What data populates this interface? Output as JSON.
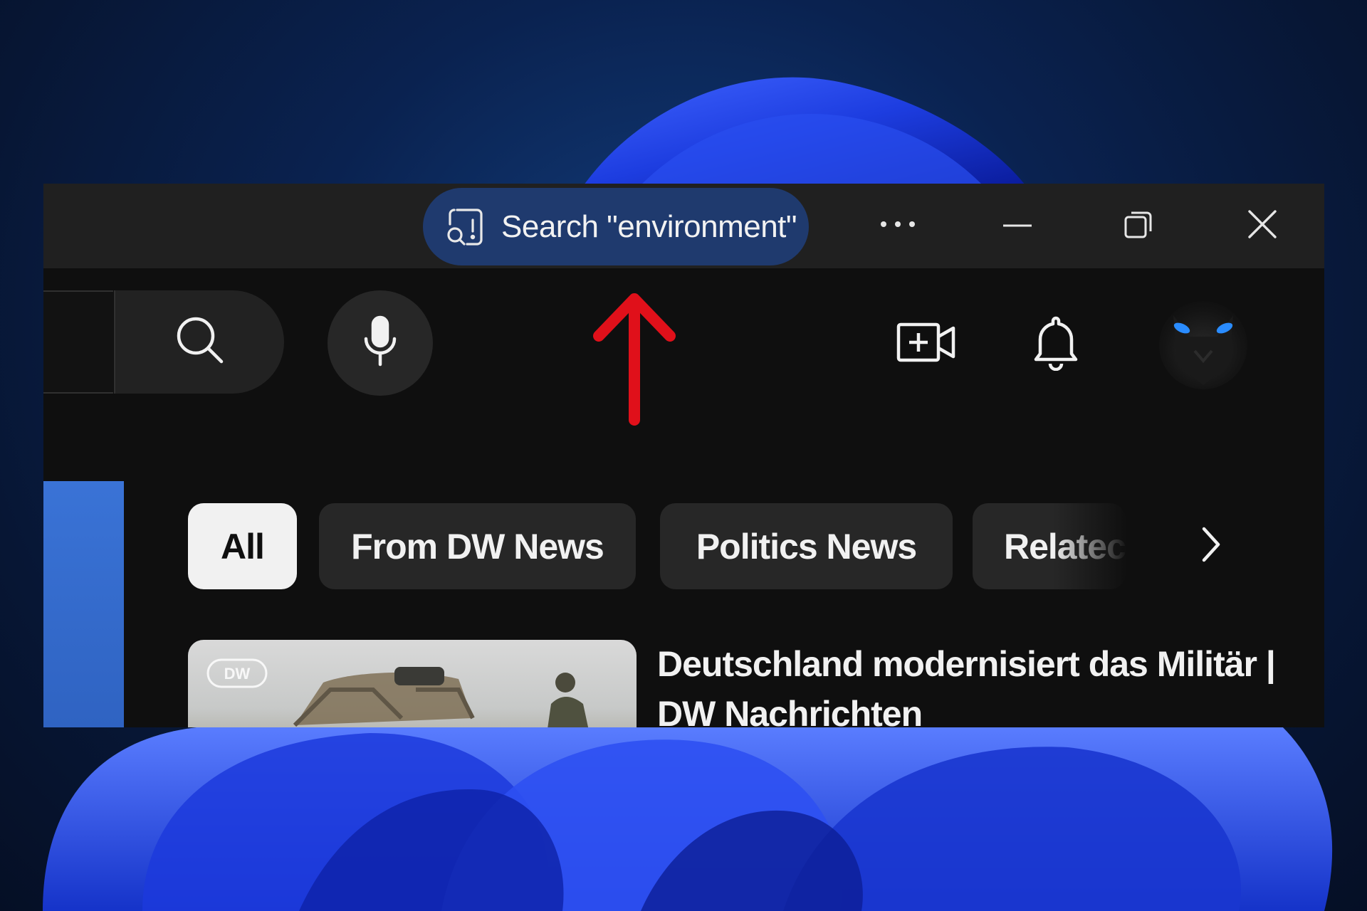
{
  "window": {
    "search_pill": {
      "text": "Search \"environment\"",
      "icon": "visual-search-icon"
    },
    "controls": {
      "more": "more-icon",
      "minimize": "minimize-icon",
      "restore": "restore-icon",
      "close": "close-icon"
    }
  },
  "toolbar": {
    "search_icon": "search-icon",
    "mic_icon": "microphone-icon",
    "create_icon": "create-video-icon",
    "bell_icon": "bell-icon",
    "annotation_arrow_color": "#e0101a"
  },
  "chips": [
    {
      "label": "All",
      "active": true
    },
    {
      "label": "From DW News",
      "active": false
    },
    {
      "label": "Politics News",
      "active": false
    },
    {
      "label": "Relatec",
      "active": false
    }
  ],
  "video": {
    "title": "Deutschland modernisiert das Militär | DW Nachrichten",
    "channel_logo": "DW"
  },
  "colors": {
    "accent_pill": "#1f3a6e",
    "titlebar": "#202020",
    "background": "#0f0f0f",
    "chip": "#272727",
    "chip_active": "#f1f1f1"
  }
}
